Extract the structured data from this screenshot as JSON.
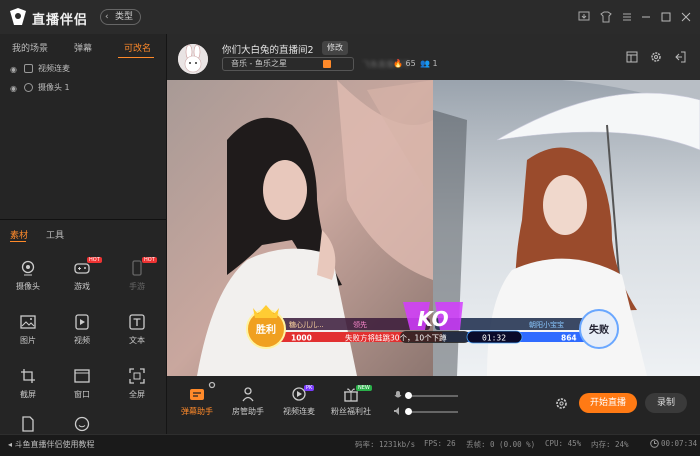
{
  "app": {
    "brand": "直播伴侣",
    "type_button": "类型"
  },
  "left_tabs": [
    "我的场景",
    "弹幕",
    "可改名"
  ],
  "scenes": [
    {
      "label": "视频连麦"
    },
    {
      "label": "摄像头 1"
    }
  ],
  "material_tabs": [
    "素材",
    "工具"
  ],
  "tools": [
    {
      "label": "摄像头",
      "icon": "camera-icon"
    },
    {
      "label": "游戏",
      "icon": "gamepad-icon",
      "badge": "HOT"
    },
    {
      "label": "手游",
      "icon": "phone-icon",
      "badge": "HOT",
      "disabled": true
    },
    {
      "label": "图片",
      "icon": "image-icon"
    },
    {
      "label": "视频",
      "icon": "video-icon"
    },
    {
      "label": "文本",
      "icon": "text-icon"
    },
    {
      "label": "截屏",
      "icon": "crop-icon"
    },
    {
      "label": "窗口",
      "icon": "window-icon"
    },
    {
      "label": "全屏",
      "icon": "fullscreen-icon"
    },
    {
      "label": "",
      "icon": "file-icon"
    },
    {
      "label": "",
      "icon": "smile-icon"
    }
  ],
  "room": {
    "title": "你们大白兔的直播间2",
    "edit_label": "修改",
    "category": "音乐 - 鱼乐之星",
    "room_id_blurred": "飞鱼直播间号",
    "heat": "65",
    "viewers": "1"
  },
  "pk": {
    "win_label": "胜利",
    "lose_label": "失败",
    "left_name": "糖心儿儿...",
    "left_tag": "领先",
    "left_score": "1000",
    "right_name": "朝阳小宝宝",
    "right_score": "864",
    "penalty": "失败方将蛙跳30个，10个下蹲",
    "timer": "01:32",
    "ko": "KO",
    "left_share": 0.54
  },
  "bottom_tools": [
    {
      "label": "弹幕助手",
      "icon": "danmaku-icon",
      "active": true
    },
    {
      "label": "房管助手",
      "icon": "admin-icon"
    },
    {
      "label": "视频连麦",
      "icon": "video-link-icon",
      "badge": "PK"
    },
    {
      "label": "粉丝福利社",
      "icon": "gift-icon",
      "badge": "NEW"
    }
  ],
  "volume": {
    "mic": 0.0,
    "speaker": 0.0
  },
  "buttons": {
    "start": "开始直播",
    "record": "录制"
  },
  "status": {
    "help": "斗鱼直播伴侣使用教程",
    "bitrate": "码率: 1231kb/s",
    "fps": "FPS: 26",
    "dropped": "丢帧: 0 (0.00 %)",
    "cpu": "CPU: 45%",
    "memory": "内存: 24%",
    "time": "00:07:34"
  },
  "colors": {
    "accent": "#ff7a14",
    "pk_red": "#e23030",
    "pk_blue": "#2f6bff"
  }
}
